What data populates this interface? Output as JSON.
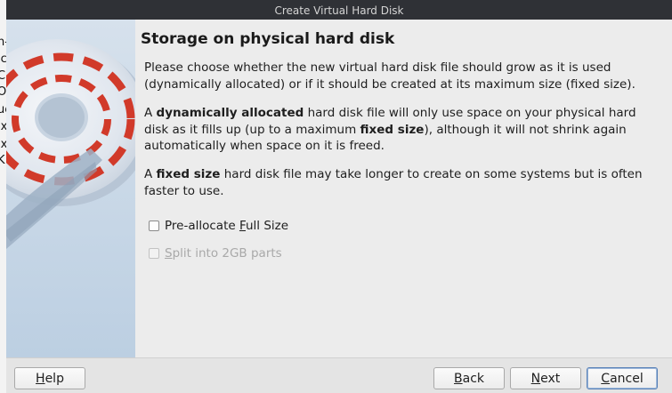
{
  "window": {
    "title": "Create Virtual Hard Disk"
  },
  "page": {
    "title": "Storage on physical hard disk",
    "paragraph1": "Please choose whether the new virtual hard disk file should grow as it is used (dynamically allocated) or if it should be created at its maximum size (fixed size).",
    "paragraph2": {
      "p1": "A ",
      "b1": "dynamically allocated",
      "p2": " hard disk file will only use space on your physical hard disk as it fills up (up to a maximum ",
      "b2": "fixed size",
      "p3": "), although it will not shrink again automatically when space on it is freed."
    },
    "paragraph3": {
      "p1": "A ",
      "b1": "fixed size",
      "p2": " hard disk file may take longer to create on some systems but is often faster to use."
    }
  },
  "options": {
    "preallocate": {
      "before": "Pre-allocate ",
      "mnemonic": "F",
      "after": "ull Size",
      "checked": false,
      "enabled": true
    },
    "split": {
      "mnemonic": "S",
      "after": "plit into 2GB parts",
      "checked": false,
      "enabled": false
    }
  },
  "buttons": {
    "help": {
      "mnemonic": "H",
      "rest": "elp"
    },
    "back": {
      "mnemonic": "B",
      "rest": "ack"
    },
    "next": {
      "mnemonic": "N",
      "rest": "ext"
    },
    "cancel": {
      "mnemonic": "C",
      "rest": "ancel"
    }
  },
  "background_window": {
    "fragments": [
      "n-",
      "ic",
      "C",
      "O",
      "ue",
      "ix",
      "ix",
      "K"
    ]
  },
  "colors": {
    "titlebar": "#2f3136",
    "wizard_image_bg": "#c7d6e6",
    "disk_dashes": "#d13a2a",
    "dialog_bg": "#ececec",
    "default_button_border": "#5a82b8"
  }
}
